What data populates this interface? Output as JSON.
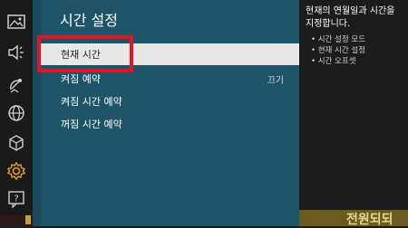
{
  "nav": {
    "icons": [
      "picture-icon",
      "sound-icon",
      "broadcast-icon",
      "network-icon",
      "apps-icon",
      "gear-icon",
      "support-icon"
    ]
  },
  "menu": {
    "title": "시간 설정",
    "items": [
      {
        "label": "현재 시간",
        "value": "",
        "selected": true
      },
      {
        "label": "켜짐 예약",
        "value": "끄기",
        "selected": false
      },
      {
        "label": "켜짐 시간 예약",
        "value": "",
        "selected": false
      },
      {
        "label": "꺼짐 시간 예약",
        "value": "",
        "selected": false
      }
    ]
  },
  "info": {
    "description": "현재의 연월일과 시간을 지정합니다.",
    "bullets": [
      "시간 설정 모드",
      "현재 시간 설정",
      "시간 오프셋"
    ]
  },
  "banner": {
    "text": "전원되되"
  },
  "colors": {
    "menu_bg": "#1e5468",
    "selected_bg": "#e8e8e8",
    "highlight": "#e3141f"
  }
}
